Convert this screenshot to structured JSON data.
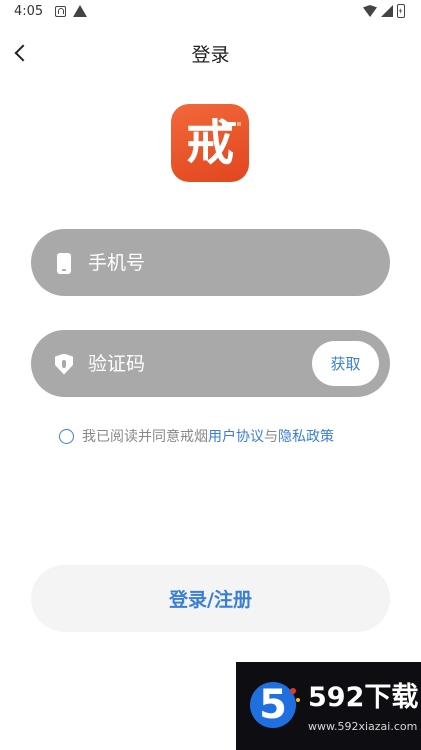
{
  "status_bar": {
    "time": "4:05"
  },
  "header": {
    "title": "登录"
  },
  "logo": {
    "text": "戒"
  },
  "form": {
    "phone_placeholder": "手机号",
    "code_placeholder": "验证码",
    "get_code_label": "获取"
  },
  "agreement": {
    "prefix": "我已阅读并同意戒烟",
    "user_agreement": "用户协议",
    "conjunction": "与",
    "privacy_policy": "隐私政策"
  },
  "submit": {
    "label": "登录/注册"
  },
  "watermark": {
    "badge": "5",
    "brand": "592下载",
    "url": "www.592xiazai.com"
  },
  "colors": {
    "accent": "#3a7fd5",
    "logo": "#e2461f",
    "field_bg": "#a9a9a9"
  },
  "icons": [
    "back-icon",
    "phone-icon",
    "shield-icon",
    "radio-icon"
  ]
}
